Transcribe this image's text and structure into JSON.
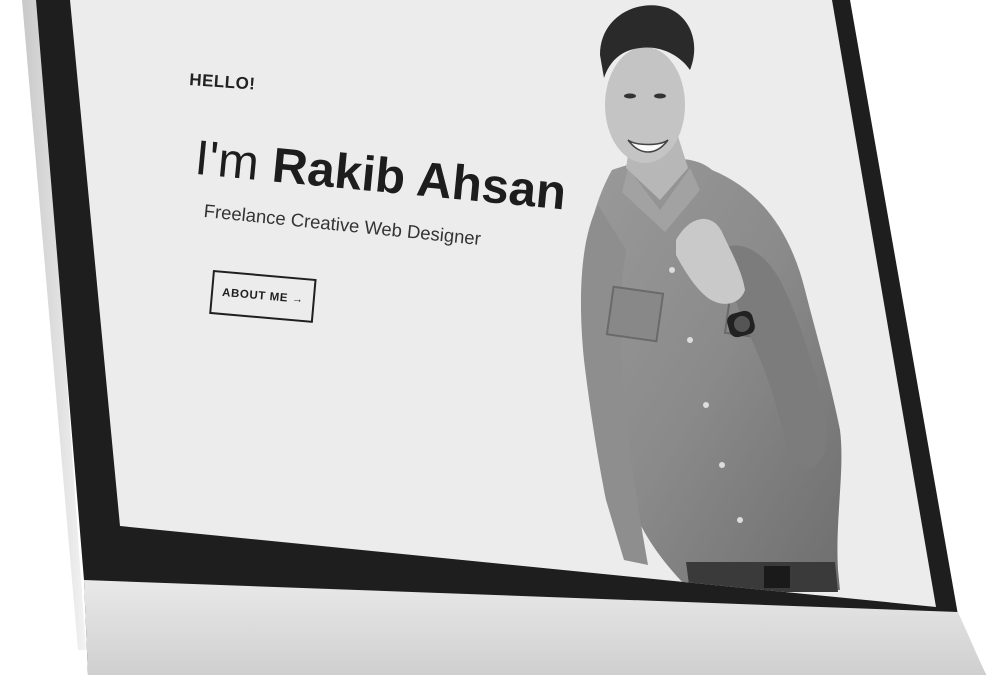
{
  "hero": {
    "greeting": "HELLO!",
    "intro": "I'm",
    "name": "Rakib Ahsan",
    "tagline": "Freelance Creative Web Designer",
    "cta_label": "ABOUT ME",
    "cta_arrow": "→"
  },
  "colors": {
    "screen_bg": "#ececec",
    "bezel": "#1e1e1e",
    "chin": "#e2e2e2",
    "text": "#1d1d1d"
  },
  "icons": {
    "cta_arrow": "right-arrow-icon"
  }
}
